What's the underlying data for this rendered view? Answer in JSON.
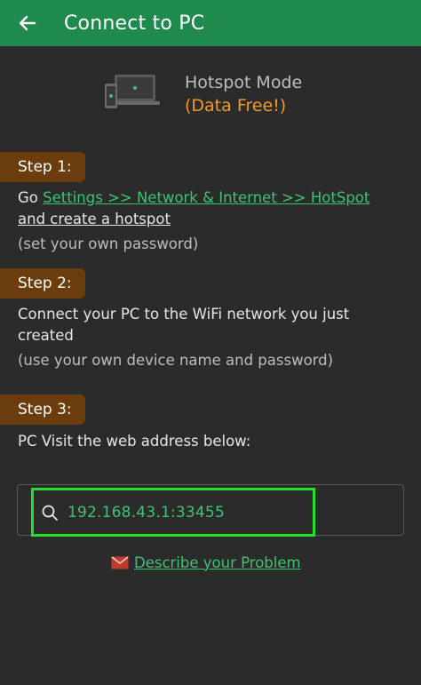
{
  "appbar": {
    "title": "Connect to PC",
    "back_icon": "arrow-left-icon",
    "color": "#1e8a4e"
  },
  "hero": {
    "icon": "devices-icon",
    "line1": "Hotspot Mode",
    "line2": "(Data Free!)"
  },
  "steps": [
    {
      "badge": "Step 1:",
      "go": "Go ",
      "link1": "Settings",
      "sep1": " >> ",
      "link2": "Network & Internet",
      "sep2": " >> ",
      "link3": "HotSpot",
      "line2": "and create a hotspot",
      "note": "(set your own password)"
    },
    {
      "badge": "Step 2:",
      "text": "Connect your PC to the WiFi network you just created",
      "note": "(use your own device name and password)"
    },
    {
      "badge": "Step 3:",
      "text": "PC Visit the web address below:"
    }
  ],
  "address": {
    "icon": "search-icon",
    "value": "192.168.43.1:33455"
  },
  "problem": {
    "icon": "mail-icon",
    "label": "Describe your Problem"
  },
  "colors": {
    "background": "#2b2b2b",
    "accent_green": "#3ec274",
    "badge_brown": "#6b3d0d",
    "orange": "#f29b1e",
    "highlight": "#22e02b"
  }
}
